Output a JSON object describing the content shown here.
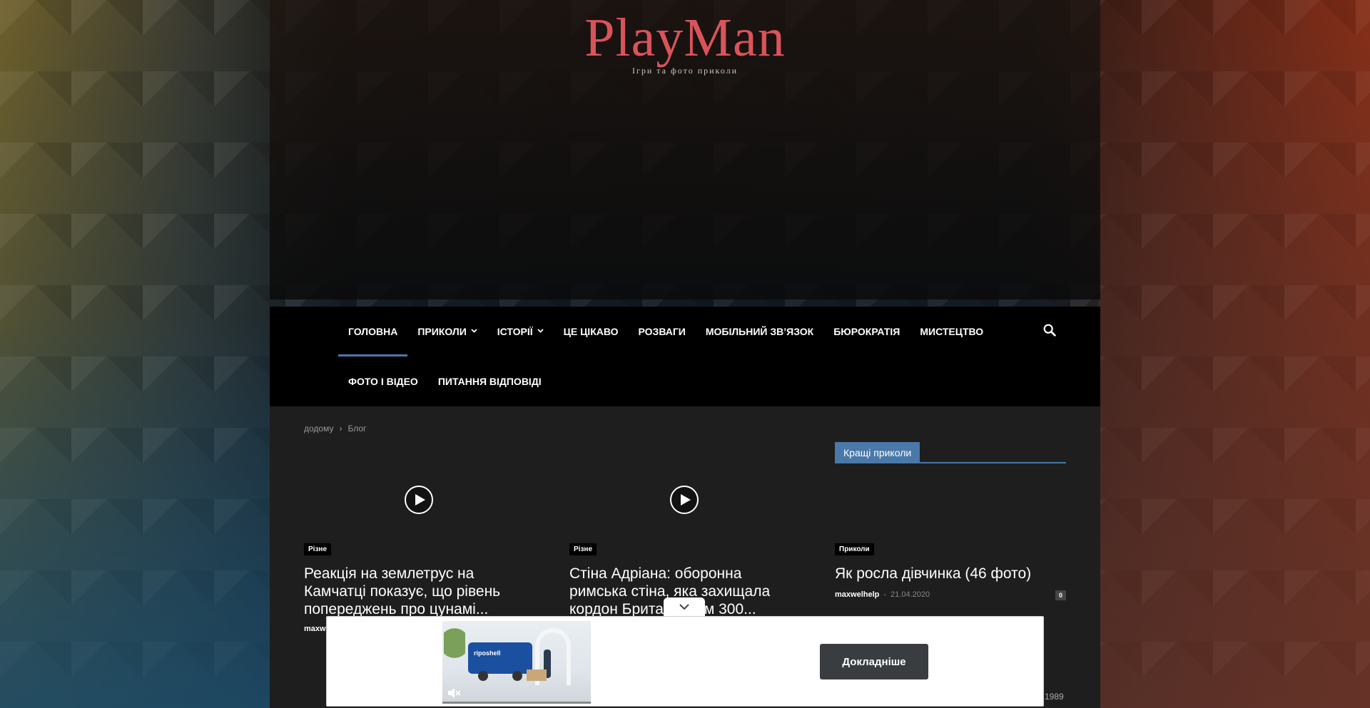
{
  "site": {
    "logo": "PlayMan",
    "tagline": "Ігри та фото приколи"
  },
  "nav": {
    "row1": [
      {
        "label": "ГОЛОВНА",
        "active": true,
        "dropdown": false
      },
      {
        "label": "ПРИКОЛИ",
        "active": false,
        "dropdown": true
      },
      {
        "label": "ІСТОРІЇ",
        "active": false,
        "dropdown": true
      },
      {
        "label": "ЦЕ ЦІКАВО",
        "active": false,
        "dropdown": false
      },
      {
        "label": "РОЗВАГИ",
        "active": false,
        "dropdown": false
      },
      {
        "label": "МОБІЛЬНИЙ ЗВ’ЯЗОК",
        "active": false,
        "dropdown": false
      },
      {
        "label": "БЮРОКРАТІЯ",
        "active": false,
        "dropdown": false
      },
      {
        "label": "МИСТЕЦТВО",
        "active": false,
        "dropdown": false
      }
    ],
    "row2": [
      {
        "label": "ФОТО І ВІДЕО",
        "active": false,
        "dropdown": false
      },
      {
        "label": "ПИТАННЯ ВІДПОВІДІ",
        "active": false,
        "dropdown": false
      }
    ],
    "search_icon": "search-icon"
  },
  "breadcrumb": {
    "home": "додому",
    "separator": "›",
    "current": "Блог"
  },
  "posts": [
    {
      "category": "Різне",
      "title": "Реакція на землетрус на Камчатці показує, що рівень попереджень про цунамі...",
      "author": "maxw"
    },
    {
      "category": "Різне",
      "title": "Стіна Адріана: оборонна римська стіна, яка захищала кордон Брита      отягом 300..."
    }
  ],
  "sidebar": {
    "block_title": "Кращі приколи",
    "post": {
      "category": "Приколи",
      "title": "Як росла дівчинка (46 фото)",
      "author": "maxwelhelp",
      "separator": "-",
      "date": "21.04.2020",
      "comments": "0"
    },
    "partial_text": "1989"
  },
  "ad": {
    "cta": "Докладніше",
    "brand_text": "riposhell",
    "collapse_icon": "chevron-down-icon",
    "mute_icon": "muted-speaker-icon"
  },
  "colors": {
    "logo": "#d9545a",
    "accent": "#4a78a8",
    "nav_bg": "#000000",
    "content_bg": "#1e1e1e",
    "cta_bg": "#3a3d40"
  }
}
